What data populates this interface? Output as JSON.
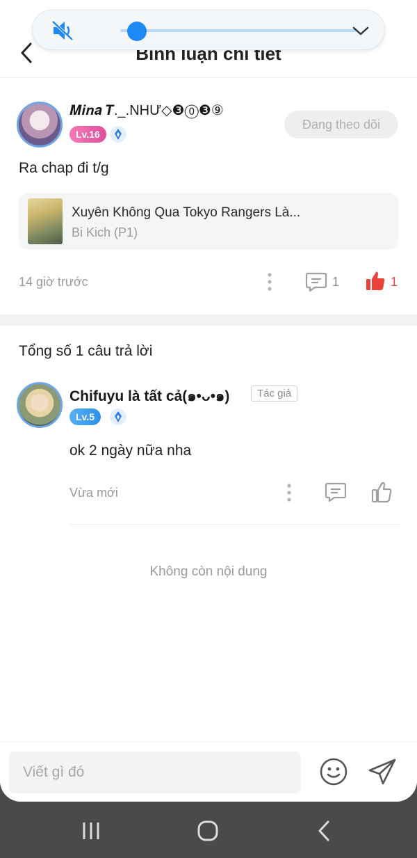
{
  "header": {
    "title": "Bình luận chi tiết"
  },
  "volume": {
    "level": 0.04
  },
  "main_comment": {
    "username": "𝑴𝒊𝒏𝒂 𝑻._.NHƯ◇❸⓪❸⑨",
    "level": "Lv.16",
    "follow_label": "Đang theo dõi",
    "text": "Ra chap đi t/g",
    "chapter": {
      "title": "Xuyên Không Qua Tokyo Rangers Là...",
      "subtitle": "Bi Kich (P1)"
    },
    "time": "14 giờ trước",
    "reply_count": "1",
    "like_count": "1"
  },
  "replies_section": {
    "total_label": "Tổng số 1 câu trả lời"
  },
  "reply": {
    "username": "Chifuyu là tất cả(๑•ᴗ•๑)",
    "author_tag": "Tác giả",
    "level": "Lv.5",
    "text": "ok 2 ngày nữa nha",
    "time": "Vừa mới"
  },
  "end_label": "Không còn nội dung",
  "input": {
    "placeholder": "Viết gì đó"
  },
  "colors": {
    "accent_blue": "#1e88f5",
    "like_red": "#e8423a",
    "level_pink": "#e04f9a",
    "level_blue": "#2f8fe9"
  },
  "icons": [
    "mute-icon",
    "chevron-down-icon",
    "back-arrow-icon",
    "more-vertical-icon",
    "comment-icon",
    "thumbs-up-icon",
    "gem-icon",
    "emoji-icon",
    "send-icon",
    "recent-apps-icon",
    "home-icon",
    "nav-back-icon"
  ]
}
